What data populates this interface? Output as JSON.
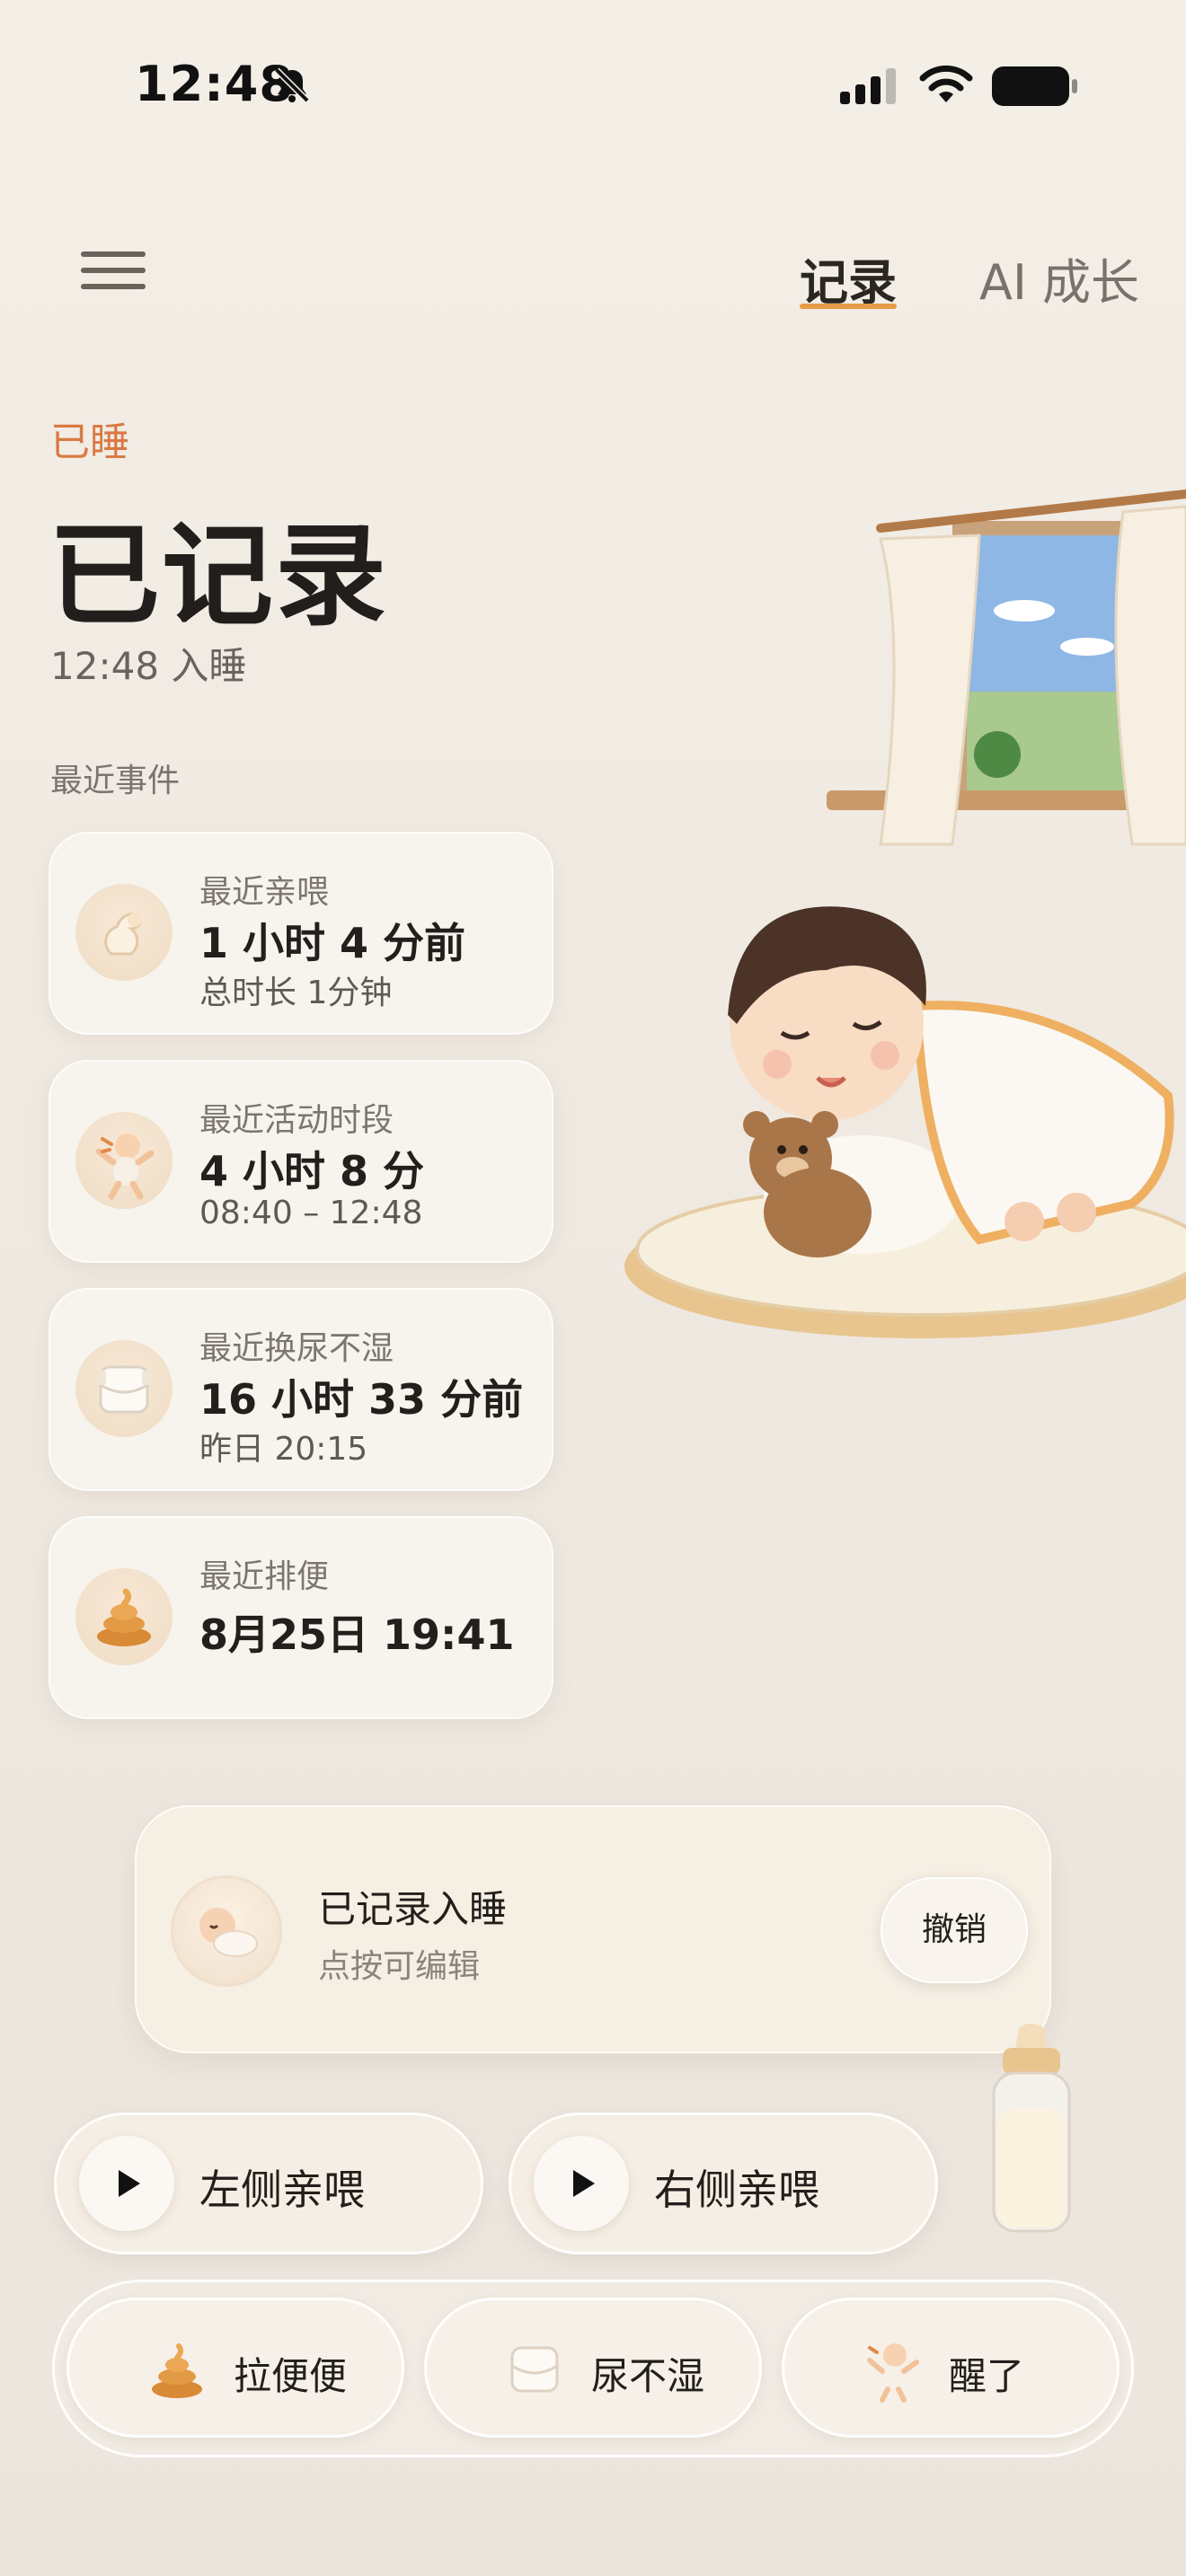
{
  "status_bar": {
    "time": "12:48",
    "icons": [
      "bell-slash-icon",
      "cellular-signal-icon",
      "wifi-icon",
      "battery-icon"
    ]
  },
  "header": {
    "menu_icon": "hamburger-menu-icon",
    "tabs": [
      {
        "label": "记录",
        "active": true
      },
      {
        "label": "AI 成长",
        "active": false
      }
    ]
  },
  "hero": {
    "status_label": "已睡",
    "title": "已记录",
    "subtitle": "12:48 入睡"
  },
  "recent_events": {
    "section_title": "最近事件",
    "cards": [
      {
        "icon": "breastfeeding-icon",
        "label": "最近亲喂",
        "main": "1 小时 4 分前",
        "sub": "总时长 1分钟"
      },
      {
        "icon": "baby-active-icon",
        "label": "最近活动时段",
        "main": "4 小时 8 分",
        "sub": "08:40 – 12:48"
      },
      {
        "icon": "diaper-icon",
        "label": "最近换尿不湿",
        "main": "16 小时 33 分前",
        "sub": "昨日 20:15"
      },
      {
        "icon": "poop-icon",
        "label": "最近排便",
        "main": "8月25日 19:41",
        "sub": ""
      }
    ]
  },
  "toast": {
    "icon": "sleeping-baby-icon",
    "title": "已记录入睡",
    "subtitle": "点按可编辑",
    "action": "撤销"
  },
  "feeding": {
    "left_label": "左侧亲喂",
    "right_label": "右侧亲喂",
    "bottle_icon": "baby-bottle-icon"
  },
  "quick_actions": [
    {
      "icon": "poop-icon",
      "label": "拉便便"
    },
    {
      "icon": "diaper-icon",
      "label": "尿不湿"
    },
    {
      "icon": "baby-awake-icon",
      "label": "醒了"
    }
  ],
  "colors": {
    "accent": "#e79a48",
    "status_label": "#d97a43",
    "background": "#efe9e1"
  }
}
